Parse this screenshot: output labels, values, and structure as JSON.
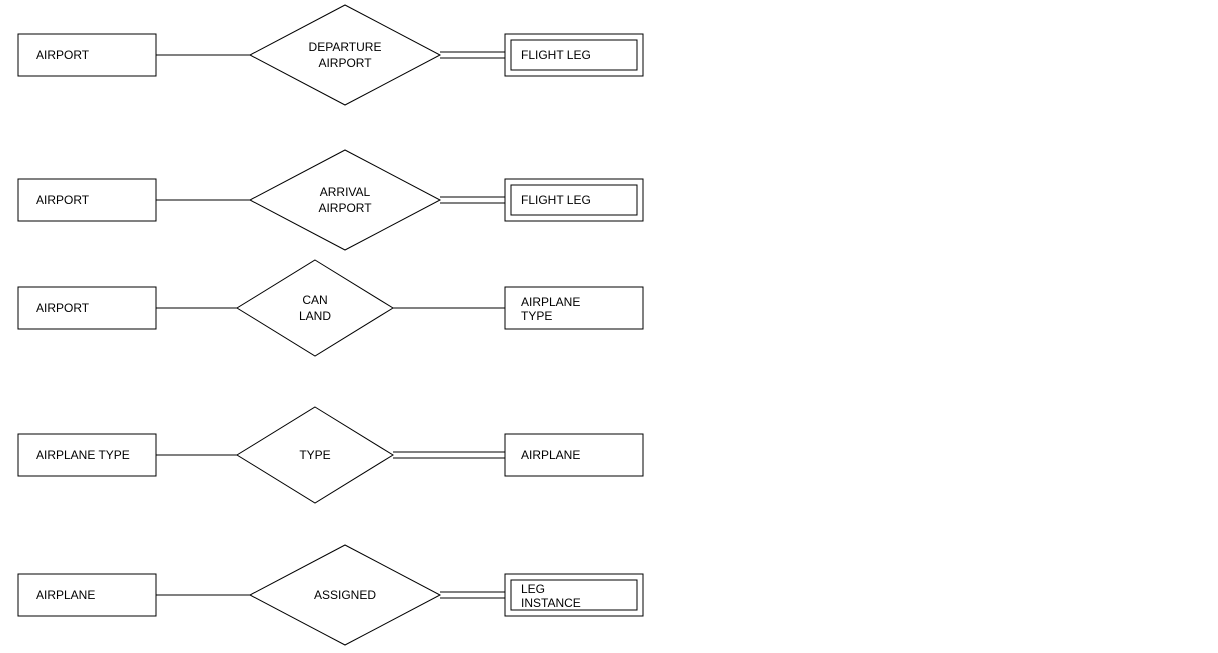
{
  "rows": [
    {
      "left_entity": "AIRPORT",
      "relationship_lines": [
        "DEPARTURE",
        "AIRPORT"
      ],
      "right_entity": "FLIGHT LEG",
      "right_weak": true,
      "right_double_line": true
    },
    {
      "left_entity": "AIRPORT",
      "relationship_lines": [
        "ARRIVAL",
        "AIRPORT"
      ],
      "right_entity": "FLIGHT LEG",
      "right_weak": true,
      "right_double_line": true
    },
    {
      "left_entity": "AIRPORT",
      "relationship_lines": [
        "CAN",
        "LAND"
      ],
      "right_entity_lines": [
        "AIRPLANE",
        "TYPE"
      ],
      "right_weak": false,
      "right_double_line": false
    },
    {
      "left_entity": "AIRPLANE TYPE",
      "relationship_lines": [
        "TYPE"
      ],
      "right_entity": "AIRPLANE",
      "right_weak": false,
      "right_double_line": true
    },
    {
      "left_entity": "AIRPLANE",
      "relationship_lines": [
        "ASSIGNED"
      ],
      "right_entity_lines": [
        "LEG",
        "INSTANCE"
      ],
      "right_weak": true,
      "right_double_line": true
    }
  ]
}
